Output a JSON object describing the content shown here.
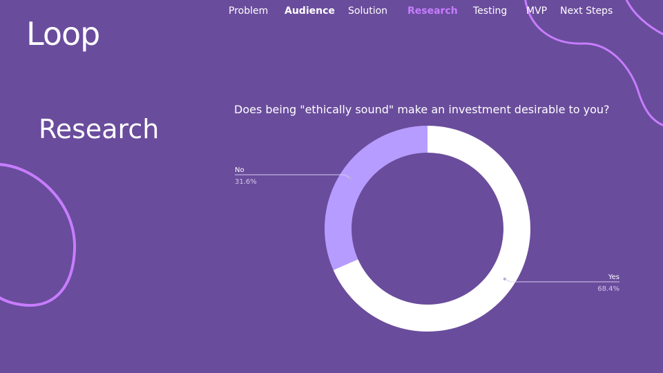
{
  "brand": {
    "logo": "Loop"
  },
  "nav": {
    "items": [
      {
        "label": "Problem",
        "style": "normal"
      },
      {
        "label": "Audience",
        "style": "bold"
      },
      {
        "label": "Solution",
        "style": "normal"
      },
      {
        "label": "Research",
        "style": "active"
      },
      {
        "label": "Testing",
        "style": "normal"
      },
      {
        "label": "MVP",
        "style": "normal"
      },
      {
        "label": "Next Steps",
        "style": "normal"
      }
    ]
  },
  "page": {
    "title": "Research"
  },
  "colors": {
    "background": "#6a4c9c",
    "accent": "#c77dff",
    "yes_slice": "#ffffff",
    "no_slice": "#b79cff"
  },
  "chart_data": {
    "type": "pie",
    "title": "Does being \"ethically sound\" make an investment desirable to you?",
    "donut": true,
    "categories": [
      "Yes",
      "No"
    ],
    "values": [
      68.4,
      31.6
    ],
    "labels": [
      "68.4%",
      "31.6%"
    ],
    "colors": [
      "#ffffff",
      "#b79cff"
    ]
  }
}
